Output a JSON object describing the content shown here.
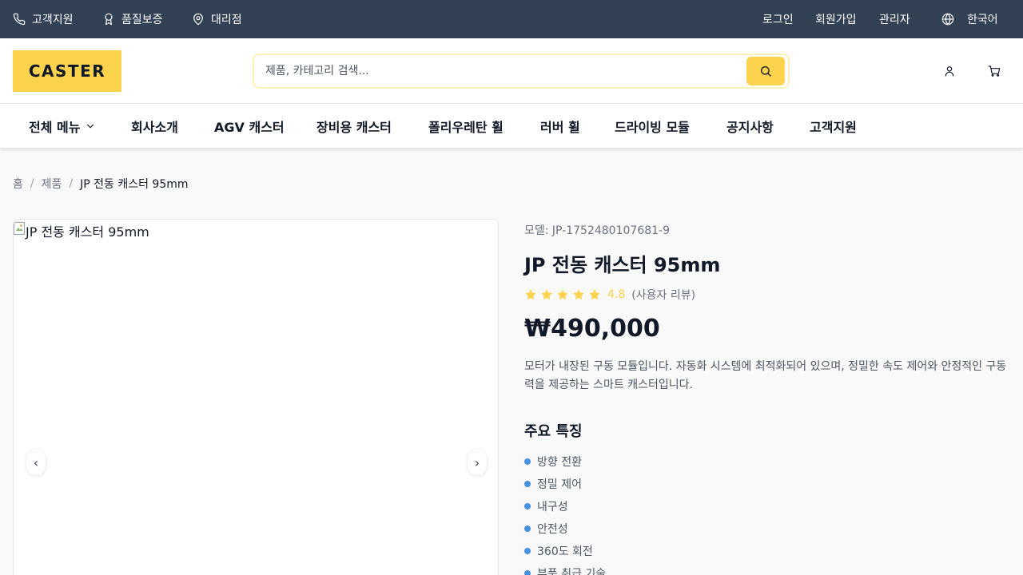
{
  "topbar": {
    "support": "고객지원",
    "quality": "품질보증",
    "dealer": "대리점",
    "login": "로그인",
    "signup": "회원가입",
    "admin": "관리자",
    "language": "한국어"
  },
  "header": {
    "logo": "CASTER",
    "search_placeholder": "제품, 카테고리 검색..."
  },
  "nav": {
    "all_menu": "전체 메뉴",
    "items": [
      "회사소개",
      "AGV 캐스터",
      "장비용 캐스터",
      "폴리우레탄 휠",
      "러버 휠",
      "드라이빙 모듈",
      "공지사항",
      "고객지원"
    ]
  },
  "breadcrumb": {
    "home": "홈",
    "products": "제품",
    "current": "JP 전동 캐스터 95mm",
    "separator": "/"
  },
  "gallery": {
    "image_alt": "JP 전동 캐스터 95mm",
    "prev": "‹",
    "next": "›"
  },
  "product": {
    "model": "모델: JP-1752480107681-9",
    "title": "JP 전동 캐스터 95mm",
    "stars": 5,
    "rating": "4.8",
    "rating_note": "(사용자 리뷰)",
    "price": "₩490,000",
    "description": "모터가 내장된 구동 모듈입니다. 자동화 시스템에 최적화되어 있으며, 정밀한 속도 제어와 안정적인 구동력을 제공하는 스마트 캐스터입니다.",
    "features_title": "주요 특징",
    "features": [
      "방향 전환",
      "정밀 제어",
      "내구성",
      "안전성",
      "360도 회전",
      "부품 취급 기술"
    ]
  },
  "colors": {
    "topbar": "#334155",
    "accent": "#fcd34d",
    "bullet": "#4a90e2"
  }
}
